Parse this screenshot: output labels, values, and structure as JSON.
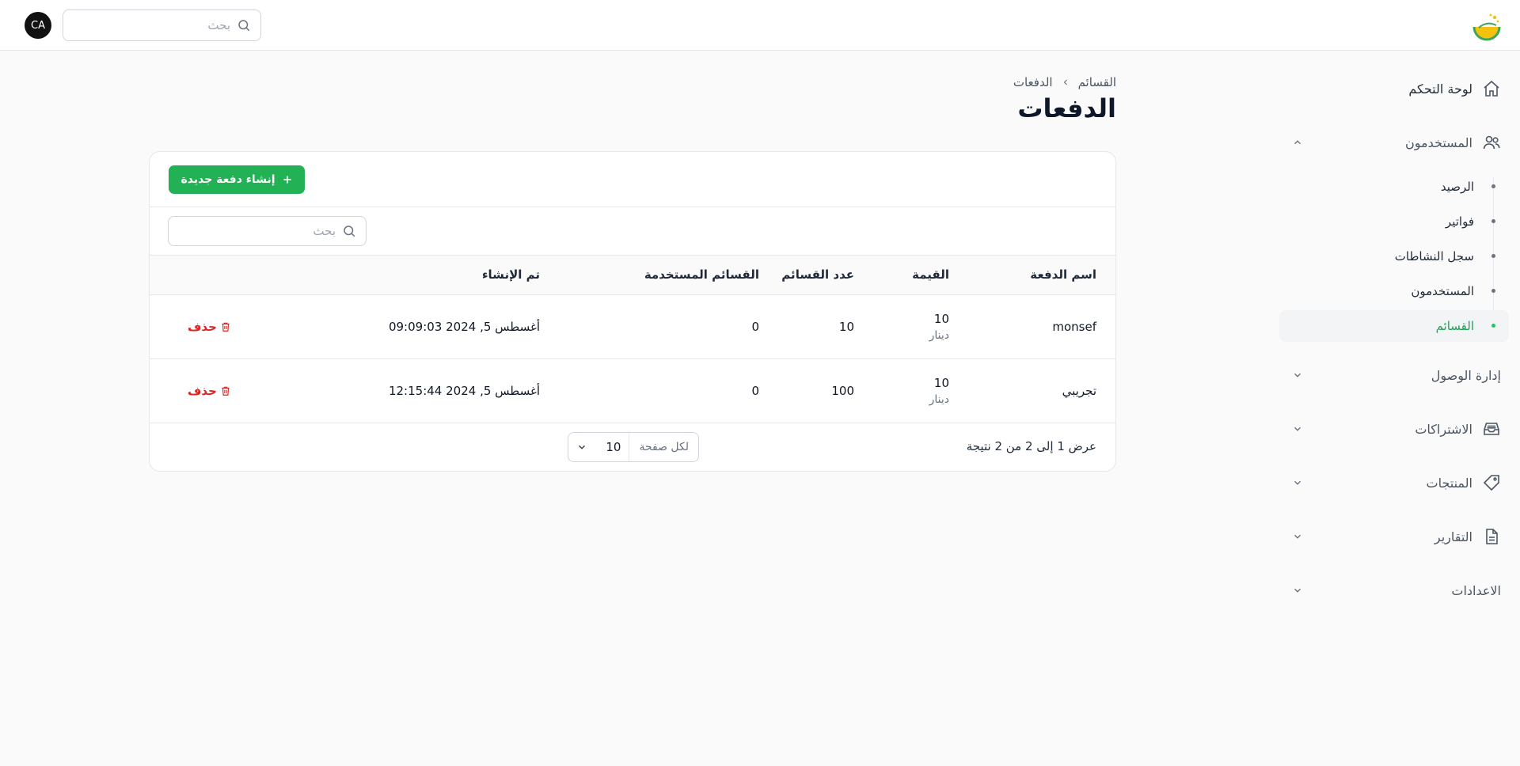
{
  "topbar": {
    "search_placeholder": "بحث",
    "avatar_initials": "CA",
    "logo_icon": "leaf-sun-logo"
  },
  "sidebar": {
    "items": [
      {
        "label": "لوحة التحكم",
        "icon": "home-icon"
      },
      {
        "label": "المستخدمون",
        "icon": "users-icon",
        "expanded": true,
        "children": [
          {
            "label": "الرصيد"
          },
          {
            "label": "فواتير"
          },
          {
            "label": "سجل النشاطات"
          },
          {
            "label": "المستخدمون"
          },
          {
            "label": "القسائم",
            "active": true
          }
        ]
      },
      {
        "label": "إدارة الوصول",
        "icon": ""
      },
      {
        "label": "الاشتراكات",
        "icon": "inbox-icon"
      },
      {
        "label": "المنتجات",
        "icon": "tag-icon"
      },
      {
        "label": "التقارير",
        "icon": "document-icon"
      },
      {
        "label": "الاعدادات",
        "icon": ""
      }
    ]
  },
  "breadcrumb": {
    "parent": "القسائم",
    "current": "الدفعات"
  },
  "page": {
    "title": "الدفعات"
  },
  "card": {
    "create_label": "إنشاء دفعة جديدة",
    "search_placeholder": "بحث",
    "columns": {
      "name": "اسم الدفعة",
      "value": "القيمة",
      "count": "عدد القسائم",
      "used": "القسائم المستخدمة",
      "created": "تم الإنشاء"
    },
    "rows": [
      {
        "name": "monsef",
        "value": "10",
        "currency": "دينار",
        "count": "10",
        "used": "0",
        "created": "أغسطس 5, 2024 09:09:03",
        "action": "حذف"
      },
      {
        "name": "تجريبي",
        "value": "10",
        "currency": "دينار",
        "count": "100",
        "used": "0",
        "created": "أغسطس 5, 2024 12:15:44",
        "action": "حذف"
      }
    ],
    "footer": {
      "results_text": "عرض 1 إلى 2 من 2 نتيجة",
      "per_page_label": "لكل صفحة",
      "per_page_value": "10"
    }
  },
  "colors": {
    "accent": "#22b155",
    "active_nav": "#22a05a",
    "danger": "#dc2626"
  }
}
